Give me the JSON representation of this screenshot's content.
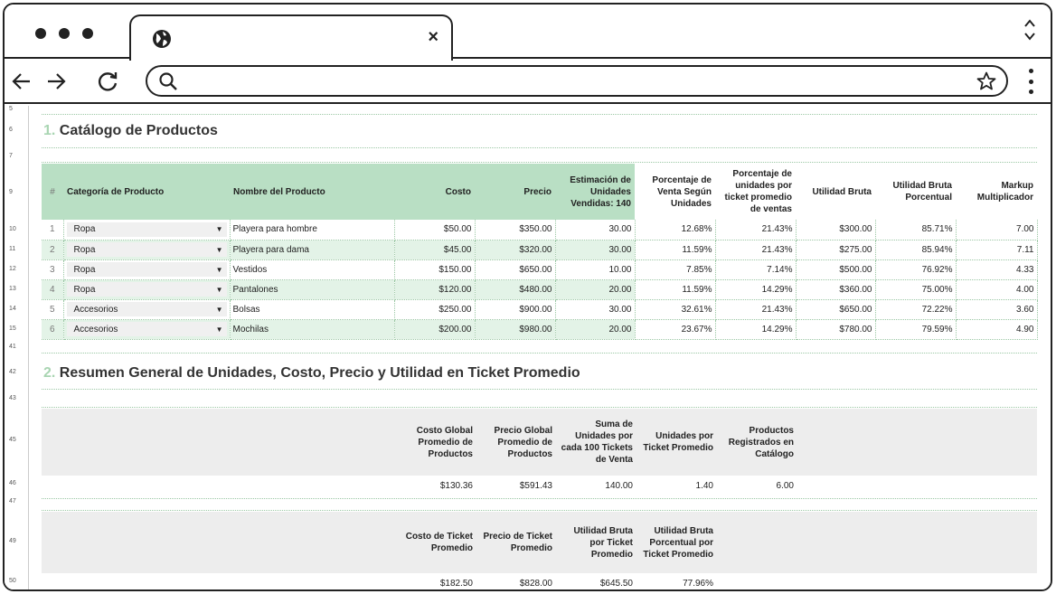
{
  "browser": {
    "tab_close": "×",
    "icons": {
      "globe": "globe-icon",
      "back": "back-arrow-icon",
      "forward": "forward-arrow-icon",
      "reload": "reload-icon",
      "search": "search-icon",
      "star": "star-icon",
      "menu": "kebab-menu-icon"
    }
  },
  "row_numbers": [
    "5",
    "6",
    "7",
    "9",
    "10",
    "11",
    "12",
    "13",
    "14",
    "15",
    "41",
    "42",
    "43",
    "45",
    "46",
    "47",
    "49",
    "50"
  ],
  "catalog": {
    "title_num": "1.",
    "title": "Catálogo de Productos",
    "headers": {
      "idx": "#",
      "category": "Categoría de Producto",
      "name": "Nombre del Producto",
      "cost": "Costo",
      "price": "Precio",
      "est_units": "Estimación de Unidades Vendidas: 140",
      "pct_sales": "Porcentaje de Venta Según Unidades",
      "pct_ticket": "Porcentaje de unidades por ticket promedio de ventas",
      "gross_profit": "Utilidad Bruta",
      "gross_profit_pct": "Utilidad Bruta Porcentual",
      "markup": "Markup Multiplicador"
    },
    "rows": [
      {
        "idx": "1",
        "category": "Ropa",
        "name": "Playera para hombre",
        "cost": "$50.00",
        "price": "$350.00",
        "units": "30.00",
        "pct_sales": "12.68%",
        "pct_ticket": "21.43%",
        "profit": "$300.00",
        "profit_pct": "85.71%",
        "markup": "7.00"
      },
      {
        "idx": "2",
        "category": "Ropa",
        "name": "Playera para dama",
        "cost": "$45.00",
        "price": "$320.00",
        "units": "30.00",
        "pct_sales": "11.59%",
        "pct_ticket": "21.43%",
        "profit": "$275.00",
        "profit_pct": "85.94%",
        "markup": "7.11"
      },
      {
        "idx": "3",
        "category": "Ropa",
        "name": "Vestidos",
        "cost": "$150.00",
        "price": "$650.00",
        "units": "10.00",
        "pct_sales": "7.85%",
        "pct_ticket": "7.14%",
        "profit": "$500.00",
        "profit_pct": "76.92%",
        "markup": "4.33"
      },
      {
        "idx": "4",
        "category": "Ropa",
        "name": "Pantalones",
        "cost": "$120.00",
        "price": "$480.00",
        "units": "20.00",
        "pct_sales": "11.59%",
        "pct_ticket": "14.29%",
        "profit": "$360.00",
        "profit_pct": "75.00%",
        "markup": "4.00"
      },
      {
        "idx": "5",
        "category": "Accesorios",
        "name": "Bolsas",
        "cost": "$250.00",
        "price": "$900.00",
        "units": "30.00",
        "pct_sales": "32.61%",
        "pct_ticket": "21.43%",
        "profit": "$650.00",
        "profit_pct": "72.22%",
        "markup": "3.60"
      },
      {
        "idx": "6",
        "category": "Accesorios",
        "name": "Mochilas",
        "cost": "$200.00",
        "price": "$980.00",
        "units": "20.00",
        "pct_sales": "23.67%",
        "pct_ticket": "14.29%",
        "profit": "$780.00",
        "profit_pct": "79.59%",
        "markup": "4.90"
      }
    ]
  },
  "summary": {
    "title_num": "2.",
    "title": "Resumen General de Unidades, Costo, Precio y Utilidad en Ticket Promedio",
    "table1": {
      "headers": [
        "Costo Global Promedio de Productos",
        "Precio Global Promedio de Productos",
        "Suma de Unidades por cada 100 Tickets de Venta",
        "Unidades por Ticket Promedio",
        "Productos Registrados en Catálogo"
      ],
      "values": [
        "$130.36",
        "$591.43",
        "140.00",
        "1.40",
        "6.00"
      ]
    },
    "table2": {
      "headers": [
        "Costo de Ticket Promedio",
        "Precio de Ticket Promedio",
        "Utilidad Bruta por Ticket Promedio",
        "Utilidad Bruta Porcentual por Ticket Promedio"
      ],
      "values": [
        "$182.50",
        "$828.00",
        "$645.50",
        "77.96%"
      ]
    }
  }
}
